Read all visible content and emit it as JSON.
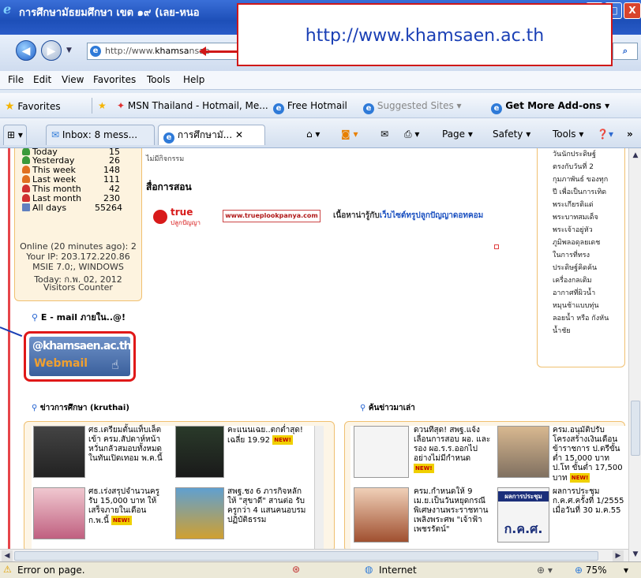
{
  "window": {
    "title": "การศึกษามัธยมศึกษา เขต ๑๙ (เลย-หนอ",
    "min": "_",
    "max": "□",
    "close": "X"
  },
  "address": {
    "url_prefix": "http://www.",
    "url_host": "khamsa",
    "url_suffix": "nsae"
  },
  "callout": {
    "text": "http://www.khamsaen.ac.th"
  },
  "menu": [
    "File",
    "Edit",
    "View",
    "Favorites",
    "Tools",
    "Help"
  ],
  "favorites": {
    "label": "Favorites",
    "items": [
      "MSN Thailand - Hotmail, Me...",
      "Free Hotmail",
      "Suggested Sites ▾",
      "Get More Add-ons ▾"
    ]
  },
  "tabs": [
    {
      "label": "Inbox: 8 mess..."
    },
    {
      "label": "การศึกษามั... ✕"
    }
  ],
  "commands": [
    "Page ▾",
    "Safety ▾",
    "Tools ▾"
  ],
  "stats": [
    {
      "label": "Today",
      "value": "15"
    },
    {
      "label": "Yesterday",
      "value": "26"
    },
    {
      "label": "This week",
      "value": "148"
    },
    {
      "label": "Last week",
      "value": "111"
    },
    {
      "label": "This month",
      "value": "42"
    },
    {
      "label": "Last month",
      "value": "230"
    },
    {
      "label": "All days",
      "value": "55264"
    }
  ],
  "visitor_info": {
    "online": "Online (20 minutes ago): 2",
    "ip": "Your IP: 203.172.220.86",
    "browser": "MSIE 7.0;, WINDOWS",
    "today": "Today: ก.พ. 02, 2012",
    "counter": "Visitors Counter"
  },
  "middle": {
    "no_activity": "ไม่มีกิจกรรม",
    "media_heading": "สื่อการสอน",
    "banner_logo_top": "true",
    "banner_logo_bottom": "ปลูกปัญญา",
    "banner_url": "www.trueplookpanya.com",
    "banner_text_prefix": "เนื้อหาน่ารู้กับ",
    "banner_text_highlight": "เว็บไซต์ทรูปลูกปัญญาดอทคอม"
  },
  "email": {
    "heading": "E - mail ภายใน..@!",
    "logo_top": "@khamsaen.ac.th",
    "logo_bottom": "Webmail"
  },
  "right_column": {
    "text": "วันนักประดิษฐ์ ตรงกับวันที่ 2 กุมภาพันธ์ ของทุกปี เพื่อเป็นการเทิดพระเกียรติแด่ พระบาทสมเด็จพระเจ้าอยู่หัวภูมิพลอดุลยเดช ในการที่ทรงประดิษฐ์คิดค้นเครื่องกลเติมอากาศที่ผิวน้ำหมุนช้าแบบทุ่นลอยน้ำ หรือ กังหันน้ำชัย"
  },
  "news_left": {
    "heading": "ข่าวการศึกษา (kruthai)",
    "items": [
      {
        "text": "ศธ.เตรียมตั้นแท็บเล็ตเข้า ครม.สัปดาห์หน้า หวั่นกลัวสมอบทั้งหมดในทันเปิดเทอม พ.ค.นี้",
        "new": "NEW!"
      },
      {
        "text": "คะแนนเฉย..ตกต่ำสุด! เฉลี่ย 19.92",
        "new": "NEW!"
      },
      {
        "text": "ศธ.เร่งสรุปจำนวนครู รับ 15,000 บาท ให้เสร็จภายในเดือน ก.พ.นี้",
        "new": "NEW!"
      },
      {
        "text": "สพฐ.ชง 6 ภารกิจหลักให้ \"สุขาดี\" สานต่อ รับครูกว่า 4 แสนคนอบรมปฏิบัติธรรม",
        "new": ""
      }
    ]
  },
  "news_right": {
    "heading": "ค้นข่าวมาเล่า",
    "items": [
      {
        "text": "ดวนที่สุด! สพฐ.แจ้งเลื่อนการสอบ ผอ. และ รอง ผอ.ร.ร.ออกไปอย่างไม่มีกำหนด",
        "new": "NEW!"
      },
      {
        "text": "ครม.อนุมัติปรับโครงสร้างเงินเดือนข้าราชการ ป.ตรีขั้นต่ำ 15,000 บาท ป.โท ขั้นต่ำ 17,500 บาท",
        "new": "NEW!"
      },
      {
        "text": "ครม.กำหนดให้ 9 เม.ย.เป็นวันหยุดกรณีพิเศษงานพระราชทานเพลิงพระศพ \"เจ้าฟ้าเพชรรัตน์\"",
        "new": ""
      },
      {
        "text": "ผลการประชุม ก.ค.ศ.ครั้งที่ 1/2555 เมื่อวันที่ 30 ม.ค.55",
        "new": ""
      }
    ],
    "thumb_caption": "ผลการประชุม",
    "thumb_caption2": "ก.ค.ศ."
  },
  "status": {
    "error": "Error on page.",
    "zone": "Internet",
    "zoom": "75%"
  }
}
